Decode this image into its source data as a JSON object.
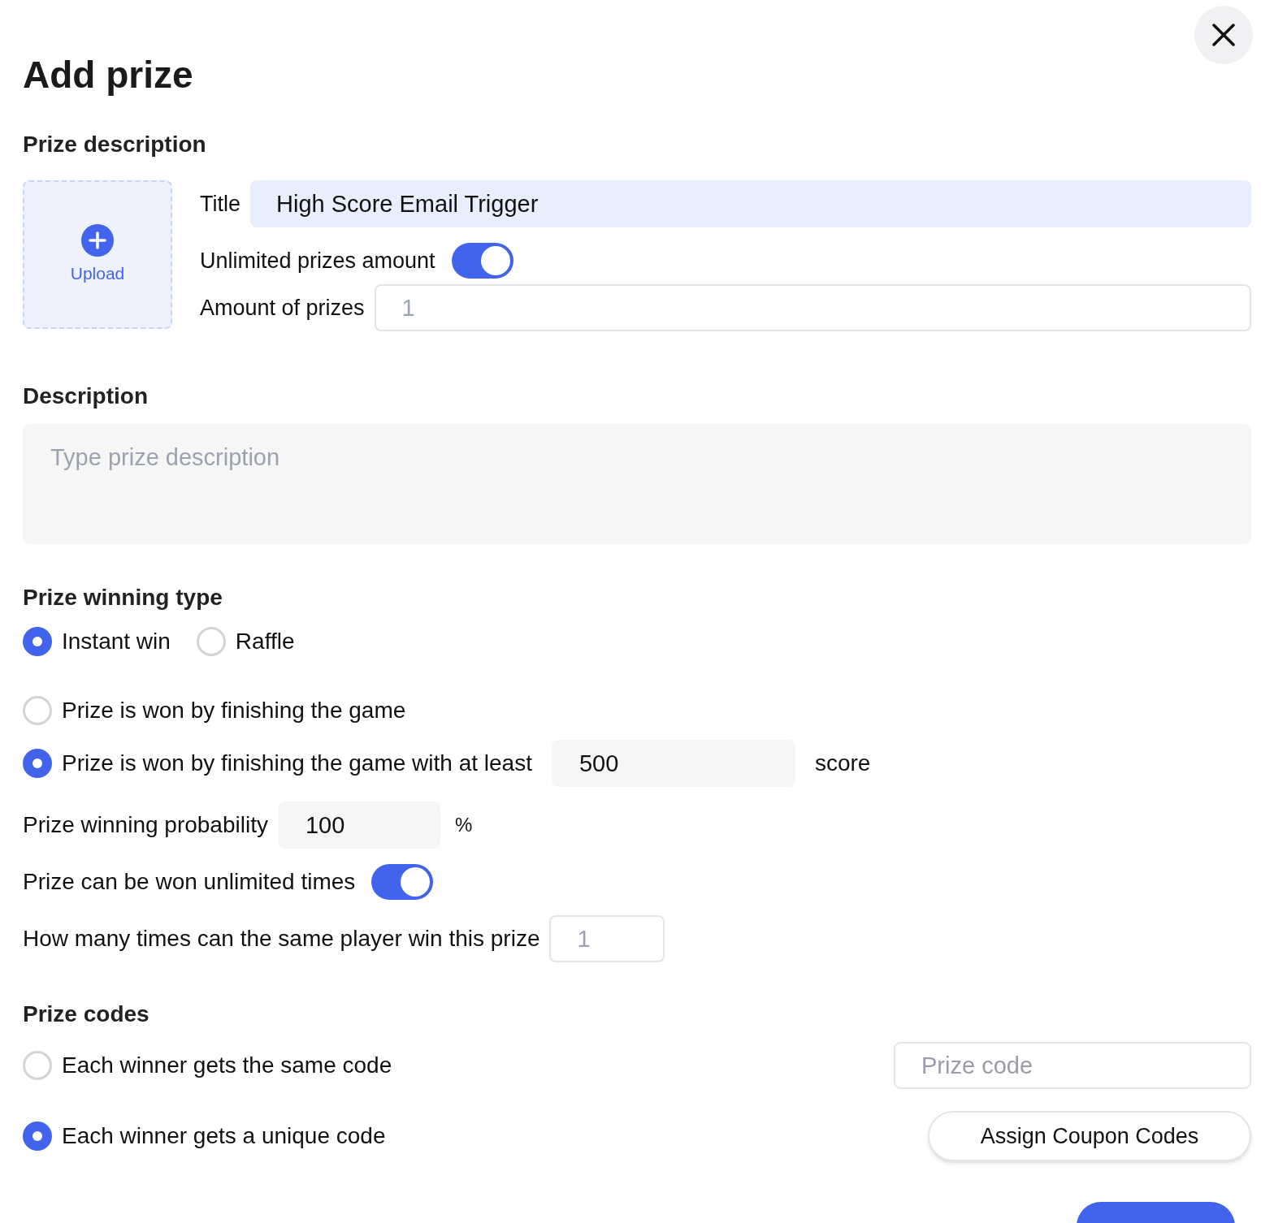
{
  "dialog": {
    "title": "Add prize"
  },
  "prize_description": {
    "heading": "Prize description",
    "upload_label": "Upload",
    "title_label": "Title",
    "title_value": "High Score Email Trigger",
    "unlimited_label": "Unlimited prizes amount",
    "unlimited_on": true,
    "amount_label": "Amount of prizes",
    "amount_placeholder": "1"
  },
  "description": {
    "heading": "Description",
    "placeholder": "Type prize description"
  },
  "winning_type": {
    "heading": "Prize winning type",
    "types": [
      {
        "label": "Instant win",
        "selected": true
      },
      {
        "label": "Raffle",
        "selected": false
      }
    ],
    "conditions": [
      {
        "kind": "plain",
        "label": "Prize is won by finishing the game",
        "selected": false
      },
      {
        "kind": "score",
        "label": "Prize is won by finishing the game with at least",
        "value": "500",
        "unit": "score",
        "selected": true
      }
    ],
    "probability_label": "Prize winning probability",
    "probability_value": "100",
    "probability_unit": "%",
    "unlimited_times_label": "Prize can be won unlimited times",
    "unlimited_times_on": true,
    "per_player_label": "How many times can the same player win this prize",
    "per_player_placeholder": "1"
  },
  "prize_codes": {
    "heading": "Prize codes",
    "options": [
      {
        "kind": "same",
        "label": "Each winner gets the same code",
        "selected": false,
        "placeholder": "Prize code"
      },
      {
        "kind": "unique",
        "label": "Each winner gets a unique code",
        "selected": true,
        "button": "Assign Coupon Codes"
      }
    ]
  }
}
